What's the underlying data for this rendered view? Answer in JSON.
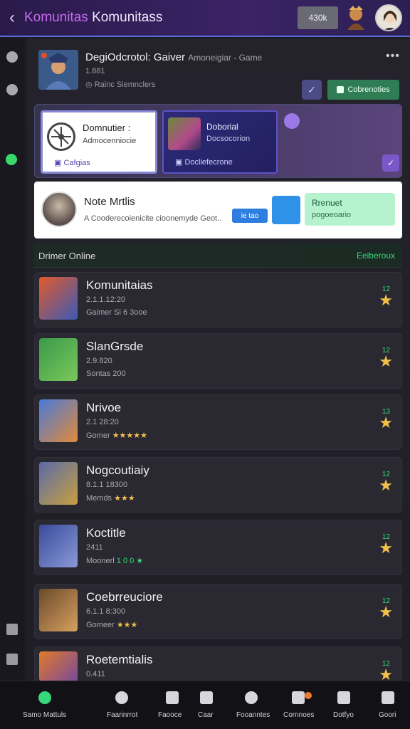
{
  "topbar": {
    "title_part1": "Komunitas",
    "title_part2": "Komunitass",
    "chip": "430k"
  },
  "game": {
    "title": "DegiOdcrotol: Gaiver",
    "title_sub": "Amoneigiar - Game",
    "count": "1.881",
    "status": "Rainc Siemnclers",
    "more": "•••",
    "join_label": "Cobrenoties"
  },
  "promo": {
    "card1": {
      "title": "Domnutier :",
      "sub": "Admocenniocie",
      "link": "Cafgias"
    },
    "card2": {
      "title": "Doborial",
      "sub": "Docsocorion",
      "link": "Docliefecrone"
    }
  },
  "note": {
    "title": "Note Mrtlis",
    "sub": "A Cooderecoienicite cioonemyde Geot..",
    "chip": "ie tao",
    "green_title": "Rrenuet",
    "green_sub": "pogoeoario"
  },
  "list": {
    "header_left": "Drimer Online",
    "header_right": "Eeiberoux",
    "items": [
      {
        "title": "Komunitaias",
        "line2": "2.1.1.12:20",
        "line3": "Gaimer Si 6 3ooe",
        "num": "12"
      },
      {
        "title": "SlanGrsde",
        "line2": "2.9.820",
        "line3": "Sontas 200",
        "num": "12"
      },
      {
        "title": "Nrivoe",
        "line2": "2.1 28:20",
        "line3": "Gomer",
        "stars": "★★★★★",
        "num": "13"
      },
      {
        "title": "Nogcoutiaiy",
        "line2": "8.1.1 18300",
        "line3": "Memds",
        "stars": "★★★",
        "num": "12"
      },
      {
        "title": "Koctitle",
        "line2": "2411",
        "line3": "Moonerl",
        "stars": "1 0 0 ★",
        "num": "12"
      },
      {
        "title": "Coebrreuciore",
        "line2": "6.1.1 8:300",
        "line3": "Gomeer",
        "stars": "★★★",
        "num": "12"
      },
      {
        "title": "Roetemtialis",
        "line2": "0.411",
        "line3": "",
        "num": "12"
      }
    ]
  },
  "bottom_nav": [
    {
      "label": "Samo Mattuls"
    },
    {
      "label": "Faarinrrot"
    },
    {
      "label": "Faooce"
    },
    {
      "label": "Caar"
    },
    {
      "label": "Fooanntes"
    },
    {
      "label": "Cornnoes"
    },
    {
      "label": "Dotfyo"
    },
    {
      "label": "Goori"
    }
  ],
  "colors": {
    "accent": "#5a6fd8",
    "green": "#36d87a",
    "star": "#f2c04a"
  }
}
